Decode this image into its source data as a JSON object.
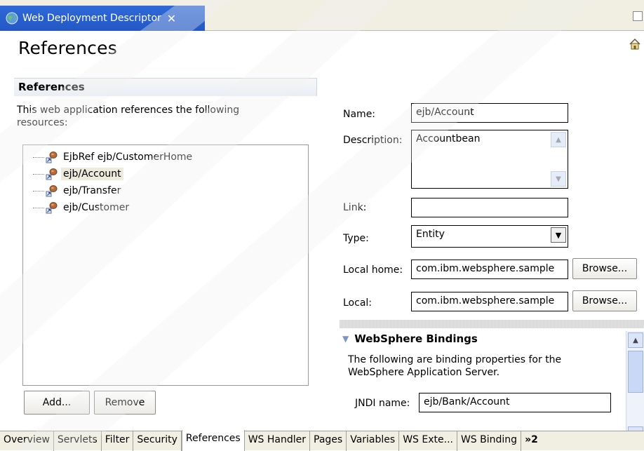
{
  "editor": {
    "tab_title": "Web Deployment Descriptor",
    "close_glyph": "✕",
    "page_title": "References"
  },
  "references": {
    "section_title": "References",
    "description": "This web application references the following resources:",
    "items": [
      {
        "label": "EjbRef ejb/CustomerHome",
        "selected": false
      },
      {
        "label": "ejb/Account",
        "selected": true
      },
      {
        "label": "ejb/Transfer",
        "selected": false
      },
      {
        "label": "ejb/Customer",
        "selected": false
      }
    ],
    "add_label": "Add...",
    "remove_label": "Remove"
  },
  "form": {
    "name_label": "Name:",
    "name_value": "ejb/Account",
    "description_label": "Description:",
    "description_value": "Accountbean",
    "link_label": "Link:",
    "link_value": "",
    "type_label": "Type:",
    "type_value": "Entity",
    "local_home_label": "Local home:",
    "local_home_value": "com.ibm.websphere.sample",
    "local_label": "Local:",
    "local_value": "com.ibm.websphere.sample",
    "browse_label": "Browse..."
  },
  "bindings": {
    "title": "WebSphere Bindings",
    "description": "The following are binding properties for the WebSphere Application Server.",
    "jndi_label": "JNDI name:",
    "jndi_value": "ejb/Bank/Account"
  },
  "page_tabs": [
    {
      "label": "Overview",
      "active": false
    },
    {
      "label": "Servlets",
      "active": false
    },
    {
      "label": "Filter",
      "active": false
    },
    {
      "label": "Security",
      "active": false
    },
    {
      "label": "References",
      "active": true
    },
    {
      "label": "WS Handler",
      "active": false
    },
    {
      "label": "Pages",
      "active": false
    },
    {
      "label": "Variables",
      "active": false
    },
    {
      "label": "WS Exte...",
      "active": false
    },
    {
      "label": "WS Binding",
      "active": false
    }
  ],
  "more_tabs": "»2",
  "colors": {
    "tab_active": "#2f6ad8",
    "tabbar_bg": "#f1efe2",
    "selection": "#ecebdc"
  }
}
